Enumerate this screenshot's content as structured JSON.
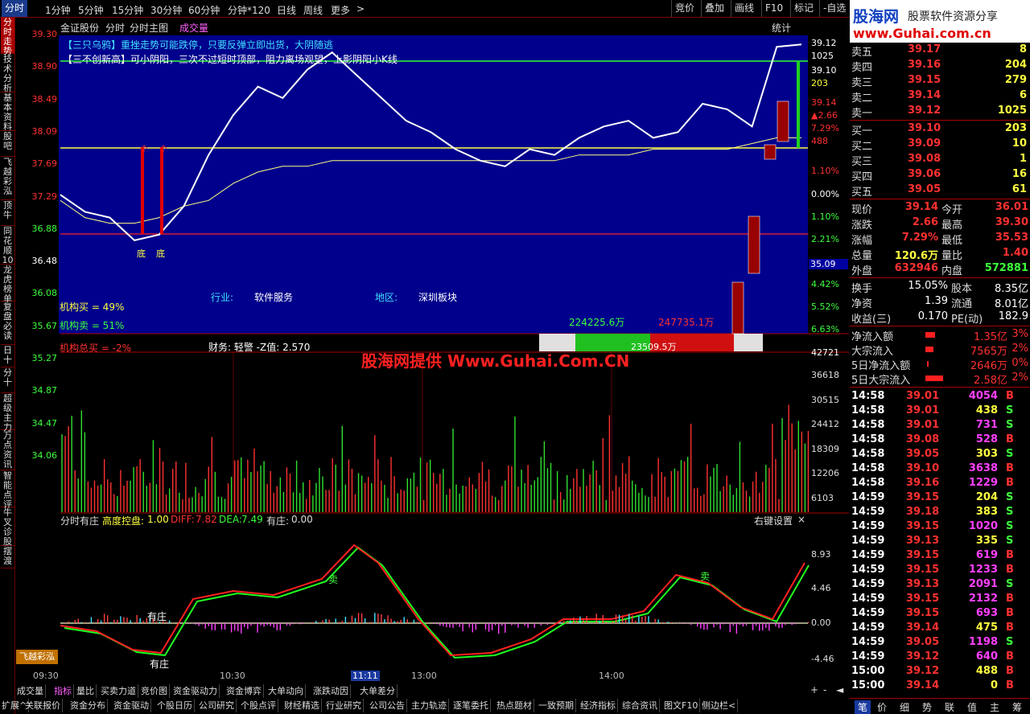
{
  "topbar": {
    "tabs": [
      "分时",
      "1分钟",
      "5分钟",
      "15分钟",
      "30分钟",
      "60分钟",
      "分钟*120",
      "日线",
      "周线",
      "更多"
    ],
    "more_arrow": ">",
    "right": [
      "竞价",
      "叠加",
      "画线",
      "F10",
      "标记",
      "-自选"
    ]
  },
  "logo": {
    "brand": "股海网",
    "slogan": "股票软件资源分享",
    "url": "www.Guhai.com.cn"
  },
  "header": {
    "stock": "金证股份",
    "view": "分时",
    "main": "分时主图",
    "indicator": "成交量",
    "stat": "统计"
  },
  "annotations": {
    "a1": "【三只乌鸦】重挫走势可能跌停，只要反弹立即出货，大阴随逃",
    "a2": "【三不创新高】可小阴阳，三次不过短时顶部，阻力离场观望，上影阴阳小K线",
    "industry_label": "行业:",
    "industry": "软件服务",
    "region_label": "地区:",
    "region": "深圳板块",
    "buy_inst": "机构买 = 49%",
    "sell_inst": "机构卖 = 51%",
    "total_inst": "机构总买 = -2%",
    "finance": "财务: 轻警  -Z值: 2.570",
    "bar_left": "224225.6万",
    "bar_right": "247735.1万",
    "bar_mid": "23509.5万",
    "bottom_mark": "底",
    "arrow_mark": "个"
  },
  "watermark": "股海网提供 Www.Guhai.Com.CN",
  "price_axis": [
    "39.30",
    "38.90",
    "38.49",
    "38.09",
    "37.69",
    "37.29",
    "36.88",
    "36.48",
    "36.08",
    "35.67",
    "35.27",
    "34.87",
    "34.47",
    "34.06"
  ],
  "right_axis": {
    "price": "39.12",
    "vol1": "1025",
    "price2": "39.10",
    "vol2": "203",
    "price3": "39.14",
    "chg": "▲2.66",
    "pct": "7.29%",
    "vol3": "488",
    "pcts": [
      "1.10%",
      "0.00%",
      "1.10%",
      "2.21%",
      "4.42%",
      "5.52%",
      "6.63%"
    ],
    "current": "35.09"
  },
  "vol_axis": [
    "42721",
    "36618",
    "30515",
    "24412",
    "18309",
    "12206",
    "6103"
  ],
  "indicator": {
    "name": "分时有庄",
    "h_label": "高度控盘:",
    "h": "1.00",
    "diff_label": "DIFF:",
    "diff": "7.82",
    "dea_label": "DEA:",
    "dea": "7.49",
    "you_label": "有庄:",
    "you": "0.00",
    "right_setting": "右键设置",
    "close": "×",
    "axis": [
      "8.93",
      "4.46",
      "0.00",
      "-4.46"
    ],
    "sell1": "卖",
    "sell2": "卖",
    "you1": "有庄",
    "you2": "有庄"
  },
  "time_axis": [
    "09:30",
    "10:30",
    "11:11",
    "13:00",
    "14:00"
  ],
  "left_nav": [
    "分时走势",
    "技术分析",
    "基本资料",
    "股吧",
    "飞越彩泓",
    "顶牛",
    "同花顺10",
    "龙虎榜单",
    "复盘必读",
    "日十",
    "分十",
    "超级主力",
    "万点资讯",
    "智能点评",
    "牛叉诊股",
    "摆渡"
  ],
  "left_badge": "飞越彩泓",
  "orderbook": {
    "sells": [
      [
        "卖五",
        "39.17",
        "8"
      ],
      [
        "卖四",
        "39.16",
        "204"
      ],
      [
        "卖三",
        "39.15",
        "279"
      ],
      [
        "卖二",
        "39.14",
        "6"
      ],
      [
        "卖一",
        "39.12",
        "1025"
      ]
    ],
    "buys": [
      [
        "买一",
        "39.10",
        "203"
      ],
      [
        "买二",
        "39.09",
        "10"
      ],
      [
        "买三",
        "39.08",
        "1"
      ],
      [
        "买四",
        "39.06",
        "16"
      ],
      [
        "买五",
        "39.05",
        "61"
      ]
    ]
  },
  "quote": [
    [
      "现价",
      "39.14",
      "今开",
      "36.01"
    ],
    [
      "涨跌",
      "2.66",
      "最高",
      "39.30"
    ],
    [
      "涨幅",
      "7.29%",
      "最低",
      "35.53"
    ],
    [
      "总量",
      "120.6万",
      "量比",
      "1.40"
    ],
    [
      "外盘",
      "632946",
      "内盘",
      "572881"
    ]
  ],
  "quote2": [
    [
      "换手",
      "15.05%",
      "股本",
      "8.35亿"
    ],
    [
      "净资",
      "1.39",
      "流通",
      "8.01亿"
    ],
    [
      "收益(三)",
      "0.170",
      "PE(动)",
      "182.9"
    ]
  ],
  "flows": [
    [
      "净流入额",
      "1.35亿",
      "3%"
    ],
    [
      "大宗流入",
      "7565万",
      "2%"
    ],
    [
      "5日净流入额",
      "2646万",
      "0%"
    ],
    [
      "5日大宗流入",
      "2.58亿",
      "2%"
    ]
  ],
  "ticks": [
    [
      "14:58",
      "39.01",
      "4054",
      "B"
    ],
    [
      "14:58",
      "39.01",
      "438",
      "S"
    ],
    [
      "14:58",
      "39.01",
      "731",
      "S"
    ],
    [
      "14:58",
      "39.08",
      "528",
      "B"
    ],
    [
      "14:58",
      "39.05",
      "303",
      "S"
    ],
    [
      "14:58",
      "39.10",
      "3638",
      "B"
    ],
    [
      "14:58",
      "39.16",
      "1229",
      "B"
    ],
    [
      "14:59",
      "39.15",
      "204",
      "S"
    ],
    [
      "14:59",
      "39.18",
      "383",
      "S"
    ],
    [
      "14:59",
      "39.15",
      "1020",
      "S"
    ],
    [
      "14:59",
      "39.13",
      "335",
      "S"
    ],
    [
      "14:59",
      "39.15",
      "619",
      "B"
    ],
    [
      "14:59",
      "39.15",
      "1233",
      "B"
    ],
    [
      "14:59",
      "39.13",
      "2091",
      "S"
    ],
    [
      "14:59",
      "39.15",
      "2132",
      "B"
    ],
    [
      "14:59",
      "39.15",
      "693",
      "B"
    ],
    [
      "14:59",
      "39.14",
      "475",
      "B"
    ],
    [
      "14:59",
      "39.05",
      "1198",
      "S"
    ],
    [
      "14:59",
      "39.12",
      "640",
      "B"
    ],
    [
      "15:00",
      "39.12",
      "488",
      "B"
    ],
    [
      "15:00",
      "39.14",
      "0",
      "B"
    ]
  ],
  "bottom_tabs": [
    "成交量",
    "指标",
    "量比",
    "买卖力道",
    "竞价图",
    "资金驱动力",
    "资金博弈",
    "大单动向",
    "涨跌动因",
    "大单差分"
  ],
  "bottom_tabs2": [
    "扩展^",
    "关联报价",
    "资金分布",
    "资金驱动",
    "个股日历",
    "公司研究",
    "个股点评",
    "财经精选",
    "行业研究",
    "公司公告",
    "主力轨迹",
    "逐笔委托",
    "热点题材",
    "一致预期",
    "经济指标",
    "综合资讯",
    "图文F10",
    "侧边栏<"
  ],
  "rpanel_tabs": [
    "笔",
    "价",
    "细",
    "势",
    "联",
    "值",
    "主",
    "筹"
  ],
  "scroll_ctrl": [
    "+",
    "-",
    "◄"
  ],
  "chart_data": {
    "type": "line",
    "title": "金证股份 分时",
    "series": [
      {
        "name": "分时",
        "values": [
          36.5,
          36.2,
          36.1,
          35.7,
          35.8,
          36.3,
          37.2,
          37.9,
          38.4,
          38.2,
          38.7,
          39.0,
          38.6,
          38.2,
          37.8,
          37.6,
          37.3,
          37.1,
          37.0,
          37.3,
          37.2,
          37.5,
          37.7,
          37.8,
          37.5,
          37.6,
          38.1,
          38.0,
          37.7,
          39.1,
          39.14
        ]
      },
      {
        "name": "均线",
        "values": [
          36.4,
          36.1,
          36.0,
          36.0,
          36.1,
          36.3,
          36.4,
          36.7,
          36.9,
          37.0,
          37.0,
          37.1,
          37.1,
          37.1,
          37.1,
          37.1,
          37.1,
          37.1,
          37.1,
          37.1,
          37.1,
          37.2,
          37.2,
          37.2,
          37.3,
          37.3,
          37.3,
          37.3,
          37.4,
          37.5,
          37.5
        ]
      }
    ]
  }
}
